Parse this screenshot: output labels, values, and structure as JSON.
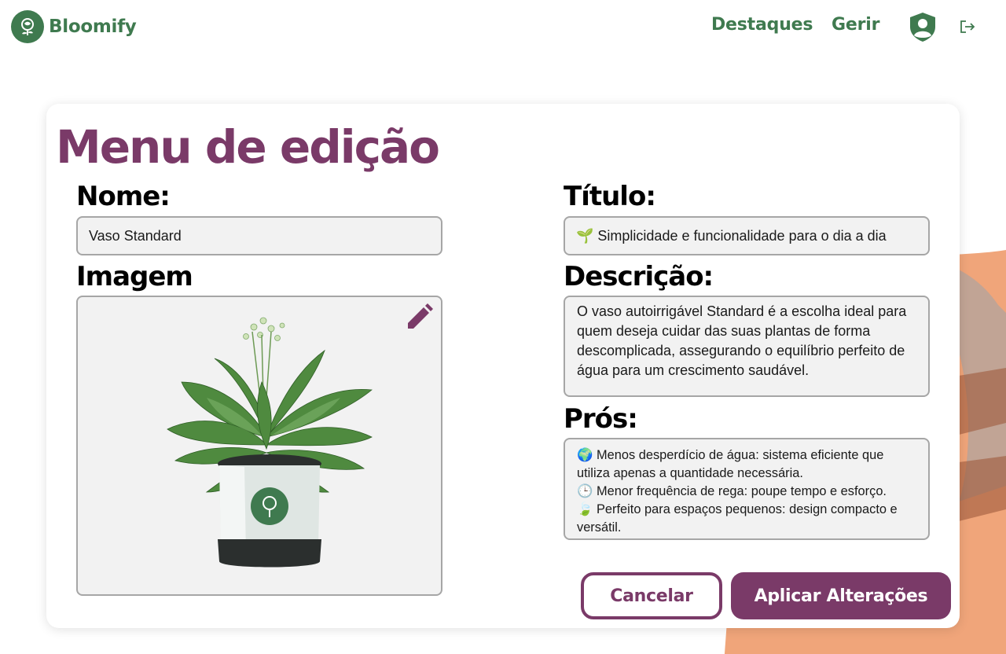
{
  "app": {
    "brand": "Bloomify",
    "accent_color": "#3f7a4f",
    "primary_color": "#7a3a68"
  },
  "header": {
    "nav": [
      "Destaques",
      "Gerir"
    ],
    "profile_icon": "user-shield-icon",
    "logout_icon": "logout-icon"
  },
  "editor": {
    "title": "Menu de edição",
    "name_label": "Nome:",
    "name_value": "Vaso Standard",
    "image_label": "Imagem",
    "image_edit_icon": "pencil-icon",
    "title_label": "Título:",
    "title_value": "🌱 Simplicidade e funcionalidade para o dia a dia",
    "description_label": "Descrição:",
    "description_value": "O vaso autoirrigável Standard é a escolha ideal para quem deseja cuidar das suas plantas de forma descomplicada, assegurando o equilíbrio perfeito de água para um crescimento saudável.",
    "pros_label": "Prós:",
    "pros": [
      "🌍 Menos desperdício de água: sistema eficiente que utiliza apenas a quantidade necessária.",
      "🕒 Menor frequência de rega: poupe tempo e esforço.",
      "🍃 Perfeito para espaços pequenos: design compacto e versátil."
    ],
    "cancel_label": "Cancelar",
    "apply_label": "Aplicar Alterações"
  }
}
